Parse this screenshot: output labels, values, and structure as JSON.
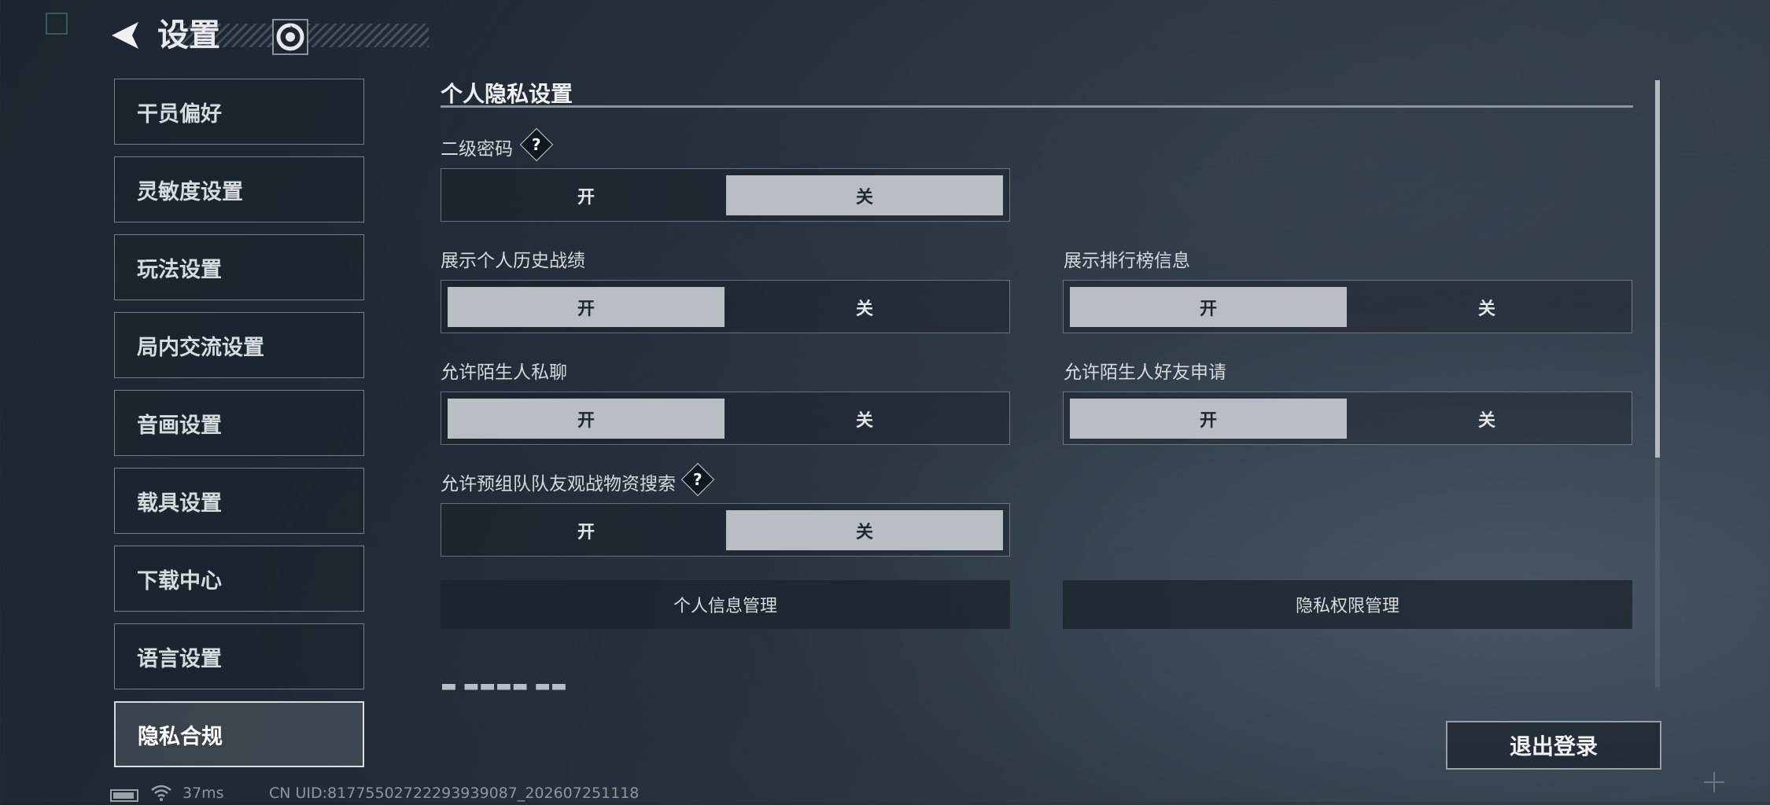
{
  "header": {
    "title": "设置",
    "back_icon": "back-arrow-icon",
    "logo_icon": "game-logo-icon"
  },
  "sidebar": {
    "items": [
      {
        "label": "干员偏好"
      },
      {
        "label": "灵敏度设置"
      },
      {
        "label": "玩法设置"
      },
      {
        "label": "局内交流设置"
      },
      {
        "label": "音画设置"
      },
      {
        "label": "载具设置"
      },
      {
        "label": "下载中心"
      },
      {
        "label": "语言设置"
      },
      {
        "label": "隐私合规",
        "active": true
      }
    ]
  },
  "section": {
    "title": "个人隐私设置",
    "settings": {
      "second_password": {
        "label": "二级密码",
        "on_label": "开",
        "off_label": "关",
        "value": "关",
        "help": "?"
      },
      "show_history": {
        "label": "展示个人历史战绩",
        "on_label": "开",
        "off_label": "关",
        "value": "开"
      },
      "show_leaderboard": {
        "label": "展示排行榜信息",
        "on_label": "开",
        "off_label": "关",
        "value": "开"
      },
      "stranger_chat": {
        "label": "允许陌生人私聊",
        "on_label": "开",
        "off_label": "关",
        "value": "开"
      },
      "stranger_friend": {
        "label": "允许陌生人好友申请",
        "on_label": "开",
        "off_label": "关",
        "value": "开"
      },
      "squad_spectate": {
        "label": "允许预组队队友观战物资搜索",
        "on_label": "开",
        "off_label": "关",
        "value": "关",
        "help": "?"
      }
    },
    "personal_info_button": "个人信息管理",
    "privacy_permission_button": "隐私权限管理"
  },
  "logout_button": "退出登录",
  "status_bar": {
    "ping": "37ms",
    "uid": "CN UID:81775502722293939087_202607251118"
  },
  "colors": {
    "toggle_on_bg": "#b9bec4",
    "background": "#222b36"
  }
}
